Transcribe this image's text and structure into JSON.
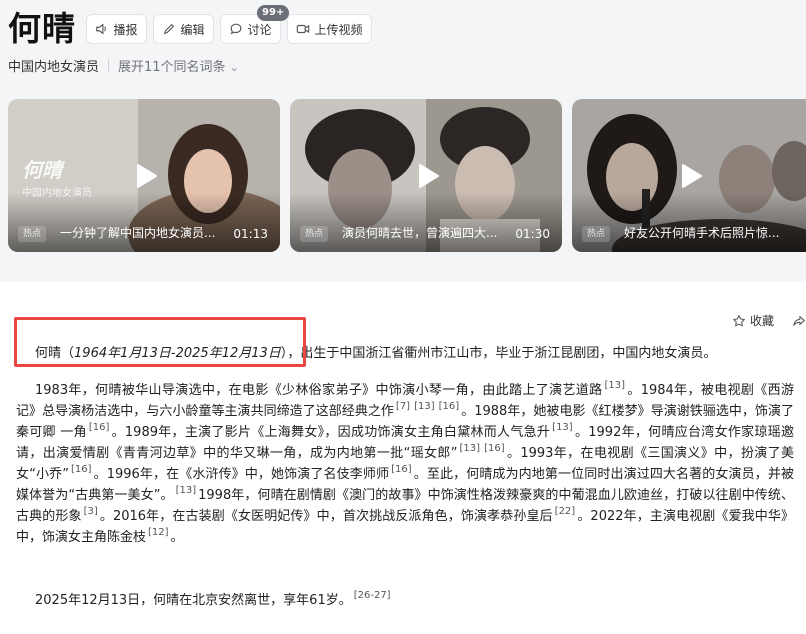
{
  "entry": {
    "title": "何晴",
    "actions": [
      {
        "label": "播报",
        "icon": "speaker-icon"
      },
      {
        "label": "编辑",
        "icon": "pencil-icon"
      },
      {
        "label": "讨论",
        "icon": "chat-bubble-icon",
        "badge": "99+"
      },
      {
        "label": "上传视频",
        "icon": "video-icon"
      }
    ],
    "subtitle": "中国内地女演员",
    "expand_label": "展开11个同名词条"
  },
  "videos": [
    {
      "caption": "一分钟了解中国内地女演员...",
      "duration": "01:13",
      "hot": "热点",
      "overlay_name": "何晴",
      "overlay_tag": "中国内地女演员"
    },
    {
      "caption": "演员何晴去世，曾演遍四大...",
      "duration": "01:30",
      "hot": "热点"
    },
    {
      "caption": "好友公开何晴手术后照片惊...",
      "duration": "",
      "hot": "热点"
    }
  ],
  "toolbar": {
    "favorite_label": "收藏",
    "share_label": "分享"
  },
  "summary": {
    "name": "何晴",
    "dates": "1964年1月13日-2025年12月13日",
    "rest": "，出生于中国浙江省衢州市江山市，毕业于浙江昆剧团，中国内地女演员。"
  },
  "career": {
    "s1": "1983年，何晴被华山导演选中，在电影《少林俗家弟子》中饰演小琴一角，由此踏上了演艺道路",
    "r1": "[13]",
    "s2": "。1984年，被电视剧《西游记》总导演杨洁选中，与六小龄童等主演共同缔造了这部经典之作",
    "r2a": "[7]",
    "r2b": "[13]",
    "r2c": "[16]",
    "s3": "。1988年，她被电影《红楼梦》导演谢铁骊选中，饰演了秦可卿 一角",
    "r3": "[16]",
    "s4": "。1989年，主演了影片《上海舞女》，因成功饰演女主角白黛林而人气急升",
    "r4": "[13]",
    "s5": "。1992年，何晴应台湾女作家琼瑶邀请，出演爱情剧《青青河边草》中的华又琳一角，成为内地第一批“瑶女郎”",
    "r5a": "[13]",
    "r5b": "[16]",
    "s6": "。1993年，在电视剧《三国演义》中，扮演了美女“小乔”",
    "r6": "[16]",
    "s7": "。1996年，在《水浒传》中，她饰演了名伎李师师",
    "r7": "[16]",
    "s8": "。至此，何晴成为内地第一位同时出演过四大名著的女演员，并被媒体誉为“古典第一美女”。",
    "r8": "[13]",
    "s9": "1998年，何晴在剧情剧《澳门的故事》中饰演性格泼辣豪爽的中葡混血儿欧迪丝，打破以往剧中传统、古典的形象",
    "r9": "[3]",
    "s10": "。2016年，在古装剧《女医明妃传》中，首次挑战反派角色，饰演孝恭孙皇后",
    "r10": "[22]",
    "s11": "。2022年，主演电视剧《爱我中华》中，饰演女主角陈金枝",
    "r11": "[12]",
    "s12": "。"
  },
  "death": {
    "text": "2025年12月13日，何晴在北京安然离世，享年61岁。",
    "ref": "[26-27]"
  },
  "colors": {
    "highlight_border": "#e8463f",
    "header_bg": "#f4f5f7"
  }
}
